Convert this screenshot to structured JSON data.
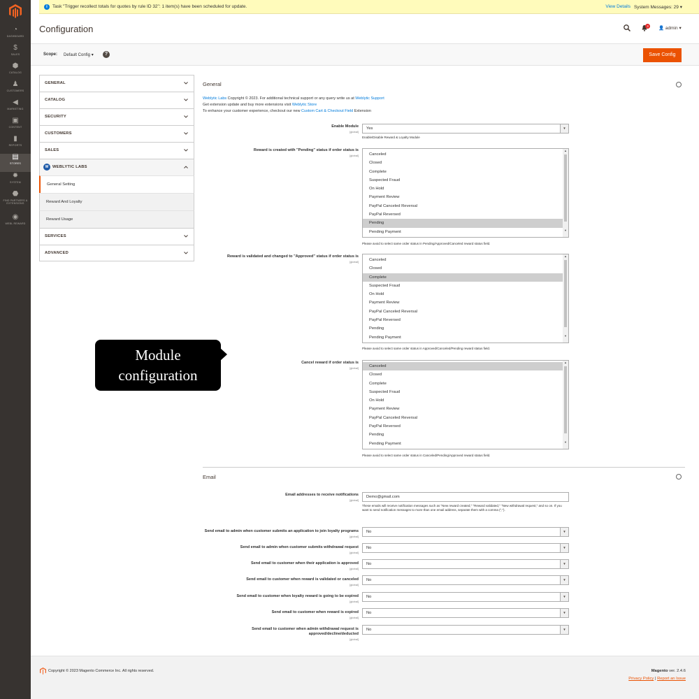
{
  "sidebar": {
    "items": [
      {
        "icon": "dashboard-icon",
        "label": "DASHBOARD"
      },
      {
        "icon": "sales-icon",
        "label": "SALES"
      },
      {
        "icon": "catalog-icon",
        "label": "CATALOG"
      },
      {
        "icon": "customers-icon",
        "label": "CUSTOMERS"
      },
      {
        "icon": "marketing-icon",
        "label": "MARKETING"
      },
      {
        "icon": "content-icon",
        "label": "CONTENT"
      },
      {
        "icon": "reports-icon",
        "label": "REPORTS"
      },
      {
        "icon": "stores-icon",
        "label": "STORES"
      },
      {
        "icon": "system-icon",
        "label": "SYSTEM"
      },
      {
        "icon": "partners-icon",
        "label": "FIND PARTNERS & EXTENSIONS"
      },
      {
        "icon": "webl-reward-icon",
        "label": "WEBL REWARD"
      }
    ],
    "active": "STORES"
  },
  "banner": {
    "message": "Task \"Trigger recollect totals for quotes by rule ID 32\": 1 item(s) have been scheduled for update.",
    "view_details": "View Details",
    "system_messages": "System Messages: 29"
  },
  "header": {
    "title": "Configuration",
    "notification_count": "3",
    "user": "admin"
  },
  "scope": {
    "label": "Scope:",
    "value": "Default Config",
    "help": "?",
    "save_label": "Save Config"
  },
  "tabs": [
    {
      "label": "GENERAL"
    },
    {
      "label": "CATALOG"
    },
    {
      "label": "SECURITY"
    },
    {
      "label": "CUSTOMERS"
    },
    {
      "label": "SALES"
    },
    {
      "label": "WEBLYTIC LABS"
    },
    {
      "label": "SERVICES"
    },
    {
      "label": "ADVANCED"
    }
  ],
  "weblytic_logo": "W",
  "subtabs": [
    {
      "label": "General Setting"
    },
    {
      "label": "Reward And Loyalty"
    },
    {
      "label": "Reward Usage"
    }
  ],
  "general": {
    "title": "General",
    "line1_link": "Weblytic Labs",
    "line1_text": " Copyright © 2023. For additional technical support or any query write us at ",
    "line1_link2": "Weblytic Support",
    "line2_text": "Get extension update and buy more extensions visit ",
    "line2_link": "Weblytic Store",
    "line3_text": "To enhance your customer experience, checkout our new ",
    "line3_link": "Custom Cart & Checkout Field",
    "line3_tail": " Extension",
    "enable_label": "Enable Module",
    "scope_global": "[global]",
    "enable_value": "Yes",
    "enable_note": "Enable/Disable Reward & Loyalty Module",
    "pending_label": "Reward is created with \"Pending\" status if order status is",
    "pending_note": "Please avoid to select same order status in Pending/Approved/Canceled reward status field.",
    "approved_label": "Reward is validated and changed to \"Approved\" status if order status is",
    "approved_note": "Please avoid to select same order status in Approved/Canceled/Pending reward status field.",
    "cancel_label": "Cancel reward if order status is",
    "cancel_note": "Please avoid to select same order status in Canceled/Pending/Approved reward status field.",
    "statuses": [
      "Canceled",
      "Closed",
      "Complete",
      "Suspected Fraud",
      "On Hold",
      "Payment Review",
      "PayPal Canceled Reversal",
      "PayPal Reversed",
      "Pending",
      "Pending Payment"
    ],
    "pending_selected": "Pending",
    "approved_selected": "Complete",
    "cancel_selected": "Canceled"
  },
  "email": {
    "title": "Email",
    "addr_label": "Email addresses to receive notifications",
    "addr_value": "Demo@gmail.com",
    "addr_note": "These emails will receive notification messages such as \"New reward created,\" \"Reward validated,\" \"New withdrawal request,\" and so on. If you want to send notification messages to more than one email address, separate them with a comma (\",\").",
    "fields": [
      {
        "label": "Send email to admin when customer submits an application to join loyalty programs",
        "value": "No"
      },
      {
        "label": "Send email to admin when customer submits withdrawal request",
        "value": "No"
      },
      {
        "label": "Send email to customer when their application is approved",
        "value": "No"
      },
      {
        "label": "Send email to customer when reward is validated or canceled",
        "value": "No"
      },
      {
        "label": "Send email to customer when loyalty reward is going to be expired",
        "value": "No"
      },
      {
        "label": "Send email to customer when reward is expired",
        "value": "No"
      },
      {
        "label": "Send email to customer when admin withdrawal request is approved/decline/deducted",
        "value": "No"
      }
    ]
  },
  "callout": {
    "line1": "Module",
    "line2": "configuration"
  },
  "footer": {
    "copyright": "Copyright © 2023 Magento Commerce Inc. All rights reserved.",
    "brand": "Magento",
    "version": " ver. 2.4.6",
    "privacy": "Privacy Policy",
    "sep": " | ",
    "report": "Report an Issue"
  },
  "colors": {
    "accent": "#eb5202",
    "sidebar": "#373330",
    "link": "#007bdb",
    "banner": "#fffbbb"
  }
}
